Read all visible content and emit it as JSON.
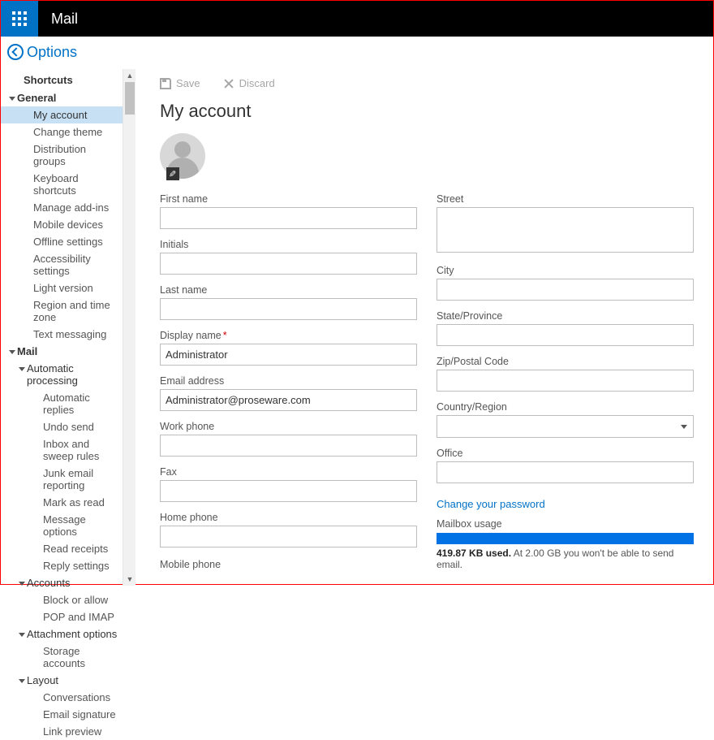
{
  "app": {
    "title": "Mail"
  },
  "options": {
    "label": "Options"
  },
  "toolbar": {
    "save_label": "Save",
    "discard_label": "Discard"
  },
  "page": {
    "title": "My account"
  },
  "nav": {
    "shortcuts": "Shortcuts",
    "general": {
      "label": "General",
      "items": [
        "My account",
        "Change theme",
        "Distribution groups",
        "Keyboard shortcuts",
        "Manage add-ins",
        "Mobile devices",
        "Offline settings",
        "Accessibility settings",
        "Light version",
        "Region and time zone",
        "Text messaging"
      ]
    },
    "mail": {
      "label": "Mail",
      "auto": {
        "label": "Automatic processing",
        "items": [
          "Automatic replies",
          "Undo send",
          "Inbox and sweep rules",
          "Junk email reporting",
          "Mark as read",
          "Message options",
          "Read receipts",
          "Reply settings"
        ]
      },
      "accounts": {
        "label": "Accounts",
        "items": [
          "Block or allow",
          "POP and IMAP"
        ]
      },
      "attach": {
        "label": "Attachment options",
        "items": [
          "Storage accounts"
        ]
      },
      "layout": {
        "label": "Layout",
        "items": [
          "Conversations",
          "Email signature",
          "Link preview"
        ]
      }
    }
  },
  "form": {
    "left": {
      "first_name": "First name",
      "initials": "Initials",
      "last_name": "Last name",
      "display_name": "Display name",
      "display_name_value": "Administrator",
      "email": "Email address",
      "email_value": "Administrator@proseware.com",
      "work_phone": "Work phone",
      "fax": "Fax",
      "home_phone": "Home phone",
      "mobile_phone": "Mobile phone"
    },
    "right": {
      "street": "Street",
      "city": "City",
      "state": "State/Province",
      "zip": "Zip/Postal Code",
      "country": "Country/Region",
      "office": "Office",
      "change_pw": "Change your password",
      "mailbox_usage": "Mailbox usage",
      "usage_bold": "419.87 KB used.",
      "usage_rest": " At 2.00 GB you won't be able to send email."
    }
  }
}
